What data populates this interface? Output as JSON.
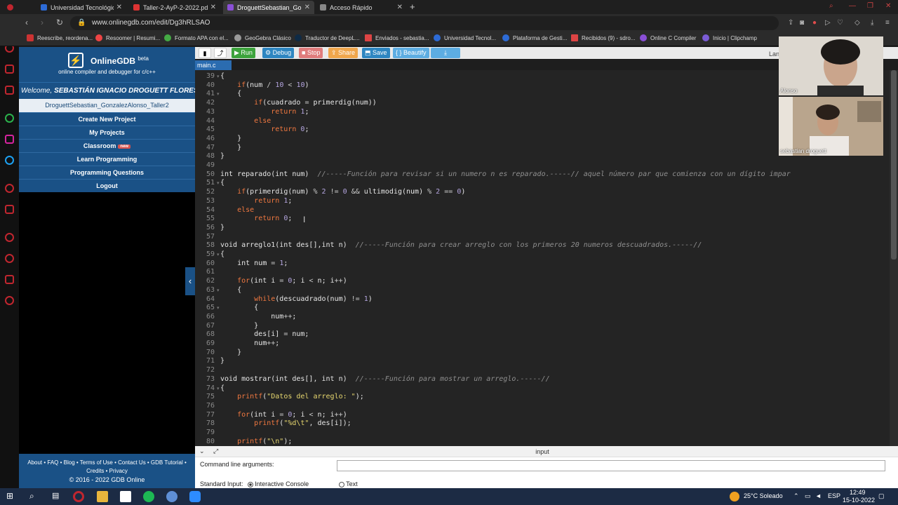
{
  "browser": {
    "tabs": [
      {
        "label": "Universidad Tecnológica M",
        "fav": "#2d6bd6",
        "active": false
      },
      {
        "label": "Taller-2-AyP-2-2022.pdf 2(",
        "fav": "#d33",
        "active": false
      },
      {
        "label": "DroguettSebastian_Gonzal",
        "fav": "#8a4fd6",
        "active": true
      },
      {
        "label": "Acceso Rápido",
        "fav": "#888",
        "active": false
      }
    ],
    "url": "www.onlinegdb.com/edit/Dg3hRLSAO",
    "bookmarks": [
      "Reescribe, reordena...",
      "Resoomer | Resumi...",
      "Formato APA con el...",
      "GeoGebra Clásico",
      "Traductor de DeepL...",
      "Enviados - sebastia...",
      "Universidad Tecnol...",
      "Plataforma de Gesti...",
      "Recibidos (9) - sdro...",
      "Online C Compiler",
      "Inicio | Clipchamp"
    ]
  },
  "sidebar": {
    "brand": "OnlineGDB",
    "beta": "beta",
    "tagline": "online compiler and debugger for c/c++",
    "welcome_prefix": "Welcome, ",
    "welcome_user": "SEBASTIÁN IGNACIO DROGUETT FLORES",
    "project_name": "DroguettSebastian_GonzalezAlonso_Taller2",
    "menu": [
      "Create New Project",
      "My Projects",
      "Classroom",
      "Learn Programming",
      "Programming Questions",
      "Logout"
    ],
    "classroom_badge": "new",
    "footer_line1": "About • FAQ • Blog • Terms of Use • Contact Us • GDB Tutorial •",
    "footer_line2": "Credits • Privacy",
    "footer_line3": "© 2016 - 2022 GDB Online"
  },
  "toolbar": {
    "run": "Run",
    "debug": "Debug",
    "stop": "Stop",
    "share": "Share",
    "save": "Save",
    "beautify": "{ } Beautify",
    "language": "Lan"
  },
  "editor": {
    "filename": "main.c",
    "lines": [
      {
        "n": "39",
        "fold": "▾",
        "html": "{"
      },
      {
        "n": "40",
        "fold": "",
        "html": "    <span class=\"kw\">if</span>(num <span class=\"op\">/</span> <span class=\"num\">10</span> <span class=\"op\">&lt;</span> <span class=\"num\">10</span>)"
      },
      {
        "n": "41",
        "fold": "▾",
        "html": "    {"
      },
      {
        "n": "42",
        "fold": "",
        "html": "        <span class=\"kw\">if</span>(cuadrado <span class=\"op\">=</span> primerdig(num))"
      },
      {
        "n": "43",
        "fold": "",
        "html": "            <span class=\"kw\">return</span> <span class=\"num\">1</span>;"
      },
      {
        "n": "44",
        "fold": "",
        "html": "        <span class=\"kw\">else</span>"
      },
      {
        "n": "45",
        "fold": "",
        "html": "            <span class=\"kw\">return</span> <span class=\"num\">0</span>;"
      },
      {
        "n": "46",
        "fold": "",
        "html": "    }"
      },
      {
        "n": "47",
        "fold": "",
        "html": "    }"
      },
      {
        "n": "48",
        "fold": "",
        "html": "}"
      },
      {
        "n": "49",
        "fold": "",
        "html": ""
      },
      {
        "n": "50",
        "fold": "",
        "html": "int reparado(int num)  <span class=\"cm\">//-----Función para revisar si un numero n es reparado.-----// aquel número par que comienza con un dígito impar</span>"
      },
      {
        "n": "51",
        "fold": "▾",
        "html": "{"
      },
      {
        "n": "52",
        "fold": "",
        "html": "    <span class=\"kw\">if</span>(primerdig(num) <span class=\"op\">%</span> <span class=\"num\">2</span> <span class=\"op\">!=</span> <span class=\"num\">0</span> <span class=\"op\">&amp;&amp;</span> ultimodig(num) <span class=\"op\">%</span> <span class=\"num\">2</span> <span class=\"op\">==</span> <span class=\"num\">0</span>)"
      },
      {
        "n": "53",
        "fold": "",
        "html": "        <span class=\"kw\">return</span> <span class=\"num\">1</span>;"
      },
      {
        "n": "54",
        "fold": "",
        "html": "    <span class=\"kw\">else</span>"
      },
      {
        "n": "55",
        "fold": "",
        "html": "        <span class=\"kw\">return</span> <span class=\"num\">0</span>;"
      },
      {
        "n": "56",
        "fold": "",
        "html": "}"
      },
      {
        "n": "57",
        "fold": "",
        "html": ""
      },
      {
        "n": "58",
        "fold": "",
        "html": "void arreglo1(int des[],int n)  <span class=\"cm\">//-----Función para crear arreglo con los primeros 20 numeros descuadrados.-----//</span>"
      },
      {
        "n": "59",
        "fold": "▾",
        "html": "{"
      },
      {
        "n": "60",
        "fold": "",
        "html": "    int num <span class=\"op\">=</span> <span class=\"num\">1</span>;"
      },
      {
        "n": "61",
        "fold": "",
        "html": ""
      },
      {
        "n": "62",
        "fold": "",
        "html": "    <span class=\"kw\">for</span>(int i <span class=\"op\">=</span> <span class=\"num\">0</span>; i <span class=\"op\">&lt;</span> n; i<span class=\"op\">++</span>)"
      },
      {
        "n": "63",
        "fold": "▾",
        "html": "    {"
      },
      {
        "n": "64",
        "fold": "",
        "html": "        <span class=\"kw\">while</span>(descuadrado(num) <span class=\"op\">!=</span> <span class=\"num\">1</span>)"
      },
      {
        "n": "65",
        "fold": "▾",
        "html": "        {"
      },
      {
        "n": "66",
        "fold": "",
        "html": "            num<span class=\"op\">++</span>;"
      },
      {
        "n": "67",
        "fold": "",
        "html": "        }"
      },
      {
        "n": "68",
        "fold": "",
        "html": "        des[i] <span class=\"op\">=</span> num;"
      },
      {
        "n": "69",
        "fold": "",
        "html": "        num<span class=\"op\">++</span>;"
      },
      {
        "n": "70",
        "fold": "",
        "html": "    }"
      },
      {
        "n": "71",
        "fold": "",
        "html": "}"
      },
      {
        "n": "72",
        "fold": "",
        "html": ""
      },
      {
        "n": "73",
        "fold": "",
        "html": "void mostrar(int des[], int n)  <span class=\"cm\">//-----Función para mostrar un arreglo.-----//</span>"
      },
      {
        "n": "74",
        "fold": "▾",
        "html": "{"
      },
      {
        "n": "75",
        "fold": "",
        "html": "    <span class=\"kw\">printf</span>(<span class=\"str\">\"Datos del arreglo: \"</span>);"
      },
      {
        "n": "76",
        "fold": "",
        "html": ""
      },
      {
        "n": "77",
        "fold": "",
        "html": "    <span class=\"kw\">for</span>(int i <span class=\"op\">=</span> <span class=\"num\">0</span>; i <span class=\"op\">&lt;</span> n; i<span class=\"op\">++</span>)"
      },
      {
        "n": "78",
        "fold": "",
        "html": "        <span class=\"kw\">printf</span>(<span class=\"str\">\"%d\\t\"</span>, des[i]);"
      },
      {
        "n": "79",
        "fold": "",
        "html": ""
      },
      {
        "n": "80",
        "fold": "",
        "html": "    <span class=\"kw\">printf</span>(<span class=\"str\">\"\\n\"</span>);"
      }
    ]
  },
  "input_panel": {
    "title": "input",
    "cmd_label": "Command line arguments:",
    "stdin_label": "Standard Input:",
    "opt_interactive": "Interactive Console",
    "opt_text": "Text"
  },
  "video": {
    "tile1_name": "Alonso",
    "tile2_name": "sebastian droguett"
  },
  "taskbar": {
    "weather": "25°C  Soleado",
    "lang": "ESP",
    "time": "12:49",
    "date": "15-10-2022"
  }
}
